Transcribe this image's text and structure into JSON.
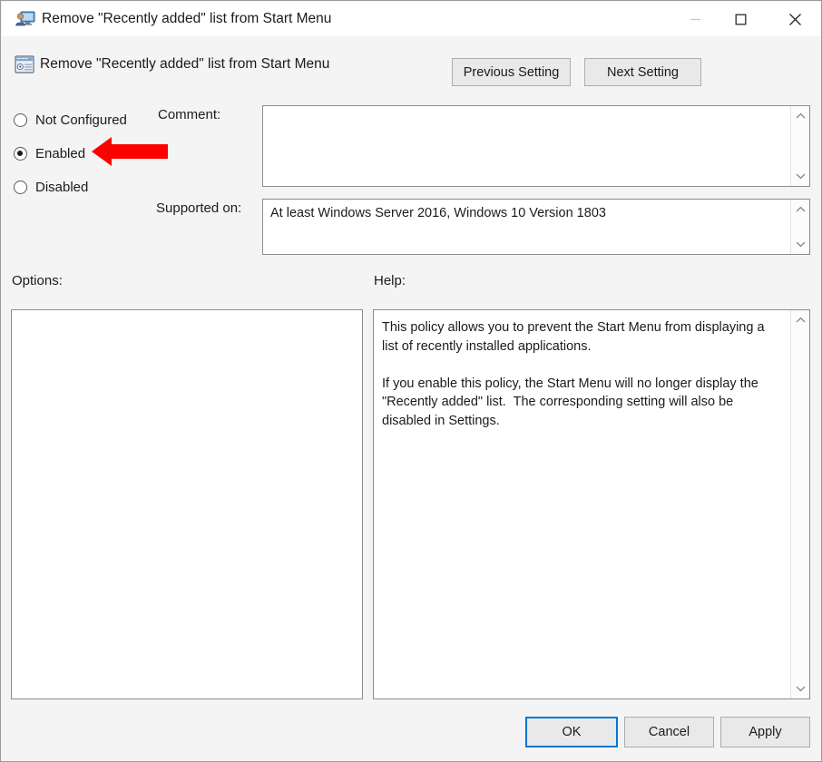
{
  "window": {
    "title": "Remove \"Recently added\" list from Start Menu",
    "icon": "policy-user-monitor-icon",
    "controls": {
      "minimize_label": "—",
      "maximize_label": "☐",
      "close_label": "✕"
    }
  },
  "header": {
    "title": "Remove \"Recently added\" list from Start Menu",
    "icon": "policy-setting-icon",
    "previous_setting_label": "Previous Setting",
    "next_setting_label": "Next Setting"
  },
  "state": {
    "options": [
      {
        "label": "Not Configured",
        "selected": false
      },
      {
        "label": "Enabled",
        "selected": true
      },
      {
        "label": "Disabled",
        "selected": false
      }
    ],
    "selected_value": "Enabled"
  },
  "annotation": {
    "type": "arrow-left",
    "color": "#FF0000",
    "points_at": "Enabled"
  },
  "comment": {
    "label": "Comment:",
    "value": "",
    "scroll_up_icon": "chevron-up-icon",
    "scroll_down_icon": "chevron-down-icon"
  },
  "supported_on": {
    "label": "Supported on:",
    "value": "At least Windows Server 2016, Windows 10 Version 1803",
    "scroll_up_icon": "chevron-up-icon",
    "scroll_down_icon": "chevron-down-icon"
  },
  "options_panel": {
    "label": "Options:",
    "value": ""
  },
  "help_panel": {
    "label": "Help:",
    "text": "This policy allows you to prevent the Start Menu from displaying a list of recently installed applications.\n\nIf you enable this policy, the Start Menu will no longer display the \"Recently added\" list.  The corresponding setting will also be disabled in Settings.",
    "scroll_up_icon": "chevron-up-icon",
    "scroll_down_icon": "chevron-down-icon"
  },
  "footer": {
    "ok_label": "OK",
    "cancel_label": "Cancel",
    "apply_label": "Apply",
    "focused_button": "OK",
    "focus_color": "#0078D7"
  }
}
